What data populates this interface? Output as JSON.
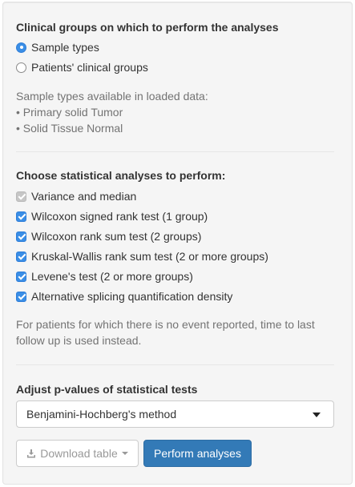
{
  "groups": {
    "heading": "Clinical groups on which to perform the analyses",
    "options": [
      {
        "label": "Sample types",
        "selected": true
      },
      {
        "label": "Patients' clinical groups",
        "selected": false
      }
    ],
    "info_title": "Sample types available in loaded data:",
    "info_items": [
      "• Primary solid Tumor",
      "• Solid Tissue Normal"
    ]
  },
  "analyses": {
    "heading": "Choose statistical analyses to perform:",
    "items": [
      {
        "label": "Variance and median",
        "checked": true,
        "disabled": true
      },
      {
        "label": "Wilcoxon signed rank test (1 group)",
        "checked": true,
        "disabled": false
      },
      {
        "label": "Wilcoxon rank sum test (2 groups)",
        "checked": true,
        "disabled": false
      },
      {
        "label": "Kruskal-Wallis rank sum test (2 or more groups)",
        "checked": true,
        "disabled": false
      },
      {
        "label": "Levene's test (2 or more groups)",
        "checked": true,
        "disabled": false
      },
      {
        "label": "Alternative splicing quantification density",
        "checked": true,
        "disabled": false
      }
    ],
    "note_line1": "For patients for which there is no event reported, time to last",
    "note_line2": "follow up is used instead."
  },
  "pvalue": {
    "heading": "Adjust p-values of statistical tests",
    "selected": "Benjamini-Hochberg's method"
  },
  "buttons": {
    "download_label": "Download table",
    "perform_label": "Perform analyses"
  },
  "colors": {
    "accent": "#3a8ee6",
    "primary_button": "#337ab7"
  }
}
